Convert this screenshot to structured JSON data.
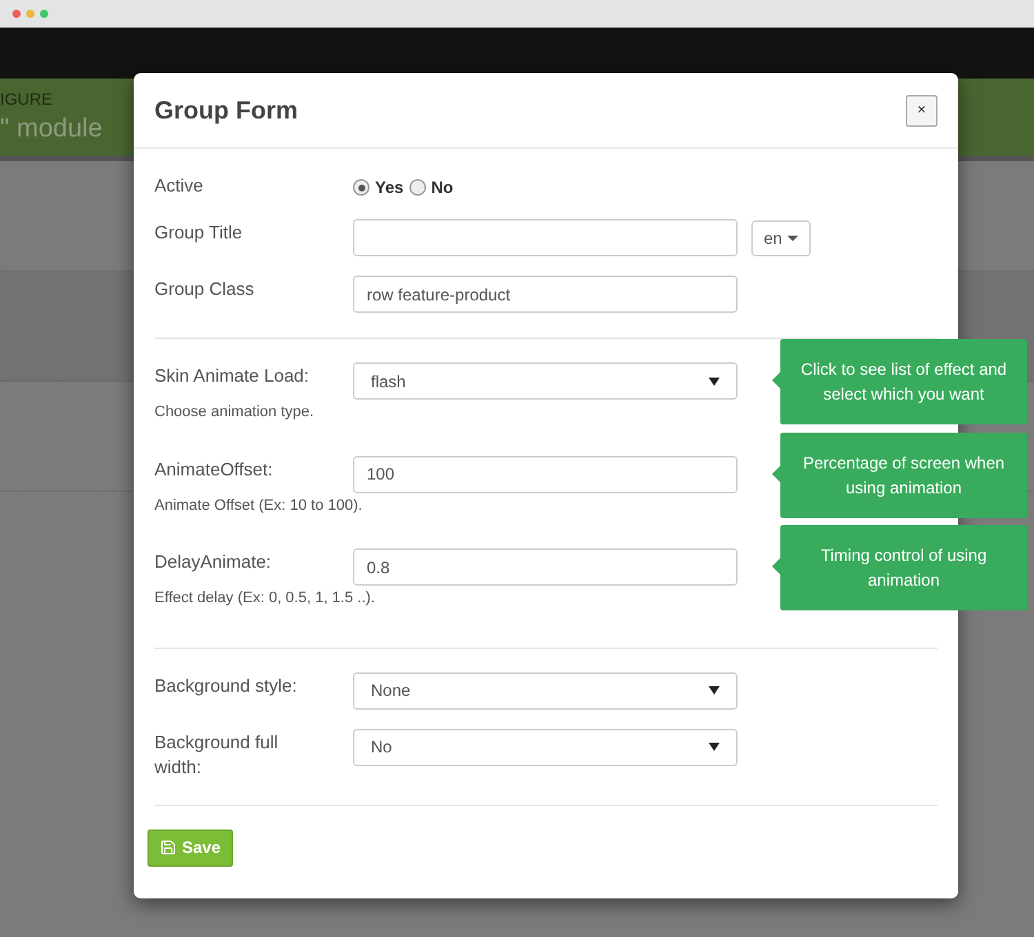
{
  "background": {
    "breadcrumb": "IGURE",
    "title": "\" module"
  },
  "modal": {
    "title": "Group Form",
    "close": "×",
    "sections": [
      {
        "fields": [
          {
            "kind": "radio",
            "label": "Active",
            "options": [
              {
                "label": "Yes",
                "selected": true
              },
              {
                "label": "No",
                "selected": false
              }
            ]
          },
          {
            "kind": "text",
            "label": "Group Title",
            "lang": "en"
          },
          {
            "kind": "text",
            "label": "Group Class",
            "value": "row feature-product"
          }
        ]
      },
      {
        "fields": [
          {
            "kind": "select",
            "label": "Skin Animate Load:",
            "value": "flash",
            "help": "Choose animation type.",
            "tooltip": "Click to see list of effect and select which you want"
          },
          {
            "kind": "text",
            "label": "AnimateOffset:",
            "value": "100",
            "help": "Animate Offset (Ex: 10 to 100).",
            "tooltip": "Percentage of screen when using animation"
          },
          {
            "kind": "text",
            "label": "DelayAnimate:",
            "value": "0.8",
            "help": "Effect delay (Ex: 0, 0.5, 1, 1.5 ..).",
            "tooltip": "Timing control of using animation"
          }
        ]
      },
      {
        "fields": [
          {
            "kind": "select",
            "label": "Background style:",
            "value": "None"
          },
          {
            "kind": "select",
            "label": "Background full width:",
            "value": "No"
          }
        ]
      }
    ],
    "save": "Save"
  }
}
